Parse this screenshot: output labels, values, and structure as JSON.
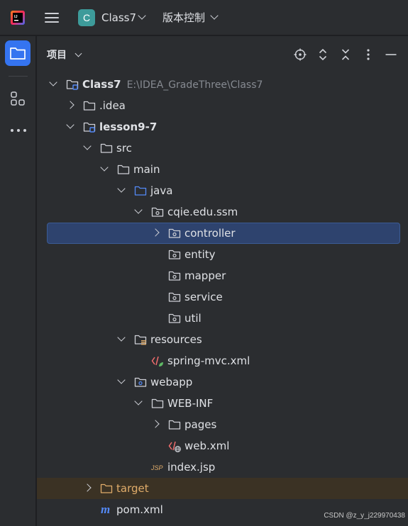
{
  "titlebar": {
    "project_initial": "C",
    "project_name": "Class7",
    "vcs_label": "版本控制"
  },
  "panel": {
    "title": "项目",
    "header_actions": [
      "locate-icon",
      "expand-all-icon",
      "collapse-all-icon",
      "more-options-icon",
      "hide-icon"
    ]
  },
  "tree": {
    "rows": [
      {
        "label": "Class7",
        "hint": "E:\\IDEA_GradeThree\\Class7",
        "icon": "module-folder-icon",
        "expanded": true
      },
      {
        "label": ".idea",
        "icon": "folder-icon",
        "expanded": false
      },
      {
        "label": "lesson9-7",
        "icon": "module-folder-icon",
        "expanded": true
      },
      {
        "label": "src",
        "icon": "folder-icon",
        "expanded": true
      },
      {
        "label": "main",
        "icon": "folder-icon",
        "expanded": true
      },
      {
        "label": "java",
        "icon": "source-root-folder-icon",
        "expanded": true
      },
      {
        "label": "cqie.edu.ssm",
        "icon": "package-icon",
        "expanded": true
      },
      {
        "label": "controller",
        "icon": "package-icon",
        "expanded": false,
        "selected": true
      },
      {
        "label": "entity",
        "icon": "package-icon"
      },
      {
        "label": "mapper",
        "icon": "package-icon"
      },
      {
        "label": "service",
        "icon": "package-icon"
      },
      {
        "label": "util",
        "icon": "package-icon"
      },
      {
        "label": "resources",
        "icon": "resources-folder-icon",
        "expanded": true
      },
      {
        "label": "spring-mvc.xml",
        "icon": "spring-xml-icon"
      },
      {
        "label": "webapp",
        "icon": "web-folder-icon",
        "expanded": true
      },
      {
        "label": "WEB-INF",
        "icon": "folder-icon",
        "expanded": true
      },
      {
        "label": "pages",
        "icon": "folder-icon",
        "expanded": false
      },
      {
        "label": "web.xml",
        "icon": "web-xml-icon"
      },
      {
        "label": "index.jsp",
        "icon": "jsp-icon",
        "icon_text": "JSP"
      },
      {
        "label": "target",
        "icon": "excluded-folder-icon",
        "expanded": false
      },
      {
        "label": "pom.xml",
        "icon": "maven-icon",
        "icon_text": "m"
      }
    ]
  },
  "watermark": "CSDN @z_y_j229970438"
}
